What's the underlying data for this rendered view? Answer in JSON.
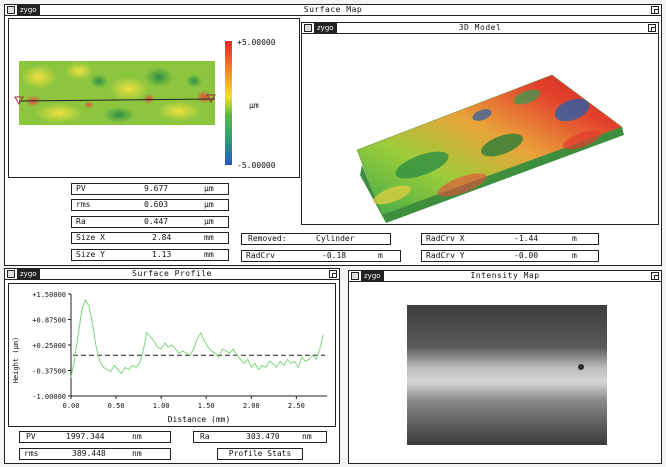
{
  "app": {
    "brand": "zygo",
    "main_title": "Surface Map"
  },
  "surface_map": {
    "scale_max": "+5.00000",
    "scale_unit": "µm",
    "scale_min": "-5.00000"
  },
  "model_3d": {
    "title": "3D Model"
  },
  "stats": {
    "pv": {
      "label": "PV",
      "value": "9.677",
      "unit": "µm"
    },
    "rms": {
      "label": "rms",
      "value": "0.603",
      "unit": "µm"
    },
    "ra": {
      "label": "Ra",
      "value": "0.447",
      "unit": "µm"
    },
    "sx": {
      "label": "Size X",
      "value": "2.84",
      "unit": "mm"
    },
    "sy": {
      "label": "Size Y",
      "value": "1.13",
      "unit": "mm"
    },
    "removed": {
      "label": "Removed:",
      "value": "Cylinder"
    },
    "radcrv": {
      "label": "RadCrv",
      "value": "-0.18",
      "unit": "m"
    },
    "radcrvx": {
      "label": "RadCrv X",
      "value": "-1.44",
      "unit": "m"
    },
    "radcrvy": {
      "label": "RadCrv Y",
      "value": "-0.00",
      "unit": "m"
    }
  },
  "profile": {
    "title": "Surface Profile",
    "pv": {
      "label": "PV",
      "value": "1997.344",
      "unit": "nm"
    },
    "rms": {
      "label": "rms",
      "value": "389.448",
      "unit": "nm"
    },
    "ra": {
      "label": "Ra",
      "value": "303.470",
      "unit": "nm"
    },
    "stats_button": "Profile Stats"
  },
  "intensity": {
    "title": "Intensity Map"
  },
  "colors": {
    "profile_line": "#7fd67f",
    "scale_top": "#e8262a",
    "scale_bottom": "#2a56c8"
  },
  "chart_data": {
    "type": "line",
    "title": "",
    "xlabel": "Distance (mm)",
    "ylabel": "Height (µm)",
    "xlim": [
      0,
      2.84
    ],
    "ylim": [
      -1.0,
      1.5
    ],
    "xticks": [
      "0.00",
      "0.50",
      "1.00",
      "1.50",
      "2.00",
      "2.50"
    ],
    "xtick_values": [
      0,
      0.5,
      1.0,
      1.5,
      2.0,
      2.5
    ],
    "yticks": [
      "+1.50000",
      "+0.87500",
      "+0.25000",
      "-0.37500",
      "-1.00000"
    ],
    "ytick_values": [
      1.5,
      0.875,
      0.25,
      -0.375,
      -1.0
    ],
    "reference_line": 0.0,
    "series": [
      {
        "x": [
          0,
          0.04,
          0.08,
          0.12,
          0.16,
          0.2,
          0.24,
          0.28,
          0.32,
          0.36,
          0.4,
          0.44,
          0.48,
          0.52,
          0.56,
          0.6,
          0.64,
          0.68,
          0.72,
          0.76,
          0.8,
          0.84,
          0.88,
          0.92,
          0.96,
          1.0,
          1.04,
          1.08,
          1.12,
          1.16,
          1.2,
          1.24,
          1.28,
          1.32,
          1.36,
          1.4,
          1.44,
          1.48,
          1.52,
          1.56,
          1.6,
          1.64,
          1.68,
          1.72,
          1.76,
          1.8,
          1.84,
          1.88,
          1.92,
          1.96,
          2.0,
          2.04,
          2.08,
          2.12,
          2.16,
          2.2,
          2.24,
          2.28,
          2.32,
          2.36,
          2.4,
          2.44,
          2.48,
          2.52,
          2.56,
          2.6,
          2.64,
          2.68,
          2.72,
          2.76,
          2.8
        ],
        "y": [
          -0.55,
          -0.1,
          0.5,
          1.1,
          1.35,
          1.2,
          0.75,
          0.2,
          -0.15,
          -0.3,
          -0.35,
          -0.4,
          -0.25,
          -0.35,
          -0.45,
          -0.3,
          -0.35,
          -0.25,
          -0.3,
          -0.2,
          0.1,
          0.55,
          0.45,
          0.35,
          0.2,
          0.15,
          0.3,
          0.2,
          0.25,
          0.15,
          0.05,
          0.1,
          0.05,
          0.0,
          0.15,
          0.4,
          0.55,
          0.35,
          0.2,
          0.1,
          0.05,
          -0.05,
          0.15,
          0.1,
          0.05,
          0.15,
          0.0,
          -0.1,
          -0.2,
          -0.1,
          -0.3,
          -0.2,
          -0.35,
          -0.25,
          -0.3,
          -0.15,
          -0.2,
          -0.3,
          -0.15,
          -0.25,
          -0.1,
          -0.2,
          -0.15,
          -0.3,
          -0.05,
          -0.15,
          -0.1,
          0.0,
          -0.1,
          0.15,
          0.5
        ]
      }
    ]
  }
}
